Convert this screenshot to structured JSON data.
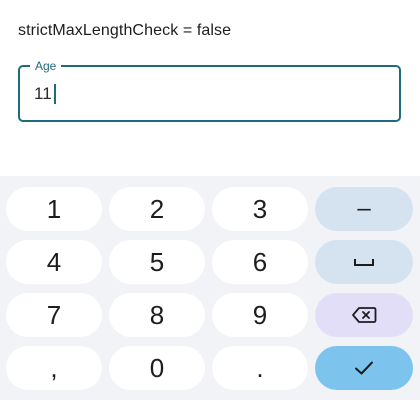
{
  "caption": "strictMaxLengthCheck = false",
  "field": {
    "label": "Age",
    "value": "11"
  },
  "keyboard": {
    "rows": [
      [
        "1",
        "2",
        "3"
      ],
      [
        "4",
        "5",
        "6"
      ],
      [
        "7",
        "8",
        "9"
      ],
      [
        ",",
        "0",
        "."
      ]
    ],
    "fn_keys": [
      "minus",
      "space",
      "backspace",
      "done"
    ],
    "minus_label": "–"
  },
  "colors": {
    "accent": "#1f6b7d",
    "keyboard_bg": "#f1f3f7",
    "key_bg": "#ffffff",
    "fn_key_bg": "#d5e3f1",
    "delete_key_bg": "#e2def8",
    "done_key_bg": "#7cc4ee"
  }
}
